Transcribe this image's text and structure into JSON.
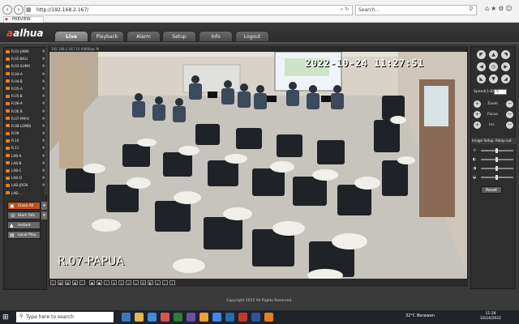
{
  "browser": {
    "address": "http://192.168.2.167/",
    "search_placeholder": "Search...",
    "tab_title": "PREVIEW"
  },
  "app": {
    "logo": "alhua",
    "menu": [
      "Live",
      "Playback",
      "Alarm",
      "Setup",
      "Info",
      "Logout"
    ],
    "active_menu": "Live"
  },
  "channels": [
    {
      "label": "R.01-JAWA",
      "mark": "M"
    },
    {
      "label": "R.02-BALI",
      "mark": "M"
    },
    {
      "label": "R.03-SUMA",
      "mark": "M"
    },
    {
      "label": "R.04-A",
      "mark": "M"
    },
    {
      "label": "R.04-B",
      "mark": "M"
    },
    {
      "label": "R.05-A",
      "mark": "M"
    },
    {
      "label": "R.05-B",
      "mark": "M"
    },
    {
      "label": "R.06-A",
      "mark": "M"
    },
    {
      "label": "R.06 B",
      "mark": "M"
    },
    {
      "label": "R.07-PAPU",
      "mark": "M"
    },
    {
      "label": "R.08-LOMBI",
      "mark": "M"
    },
    {
      "label": "R.09",
      "mark": "M"
    },
    {
      "label": "R.10",
      "mark": "M"
    },
    {
      "label": "R.11",
      "mark": "M"
    },
    {
      "label": "LAB-A",
      "mark": "M"
    },
    {
      "label": "LAB-B",
      "mark": "M"
    },
    {
      "label": "LAB-C",
      "mark": "M"
    },
    {
      "label": "LAB-D",
      "mark": "M"
    },
    {
      "label": "LAB-JRGN",
      "mark": "M"
    },
    {
      "label": "LAB-...",
      "mark": ""
    }
  ],
  "left_buttons": {
    "close_all": "Close All",
    "start_talk": "Start Talk",
    "instant_record": "Instant Record",
    "local_play": "Local Play"
  },
  "video": {
    "info_bar": "192.168.2.167 10 9066bps M",
    "timestamp": "2022-10-24 11:27:51",
    "channel_name": "R.07-PAPUA"
  },
  "ptz": {
    "speed_label": "Speed(1-8)",
    "speed_value": "5",
    "zoom_label": "Zoom",
    "focus_label": "Focus",
    "iris_label": "Iris",
    "image_setup_label": "Image Setup",
    "relay_out_label": "Relay-out",
    "reset_label": "Reset"
  },
  "footer": {
    "copyright": "Copyright 2015 All Rights Reserved."
  },
  "taskbar": {
    "search_placeholder": "Type here to search",
    "weather": "32°C  Berawan",
    "time": "11:28",
    "date": "10/24/2022"
  }
}
